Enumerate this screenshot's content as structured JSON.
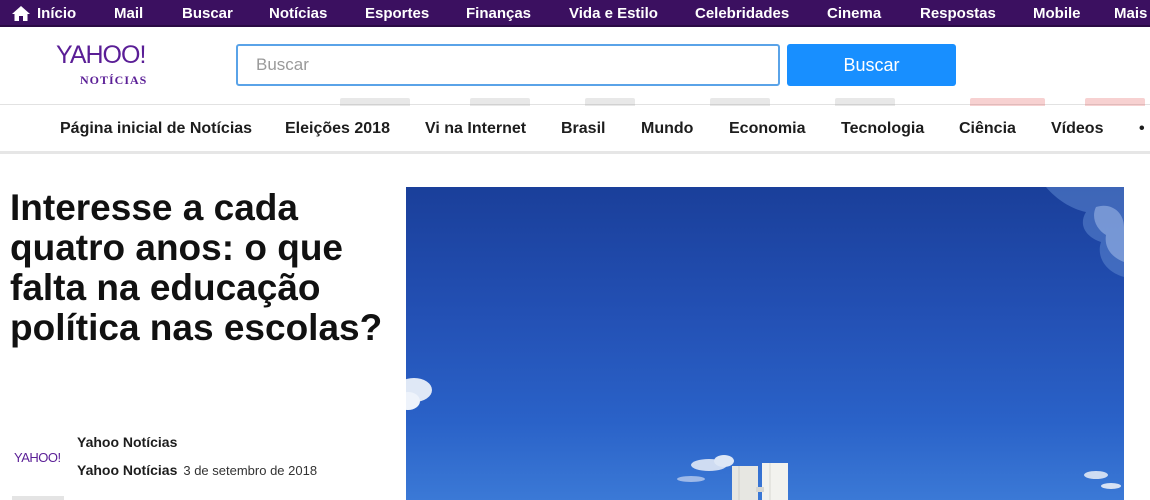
{
  "topbar": {
    "items": [
      "Início",
      "Mail",
      "Buscar",
      "Notícias",
      "Esportes",
      "Finanças",
      "Vida e Estilo",
      "Celebridades",
      "Cinema",
      "Respostas",
      "Mobile",
      "Mais"
    ],
    "icon": "home-icon",
    "background": "#3b1060"
  },
  "header": {
    "logo_main": "YAHOO!",
    "logo_sub": "NOTÍCIAS",
    "search_placeholder": "Buscar",
    "search_button": "Buscar",
    "accent": "#188fff",
    "brand": "#5a1e96"
  },
  "nav": {
    "items": [
      "Página inicial de Notícias",
      "Eleições 2018",
      "Vi na Internet",
      "Brasil",
      "Mundo",
      "Economia",
      "Tecnologia",
      "Ciência",
      "Vídeos",
      "•"
    ]
  },
  "article": {
    "headline": "Interesse a cada quatro anos: o que falta na educação política nas escolas?",
    "source_logo": "YAHOO!",
    "source_name": "Yahoo Notícias",
    "author": "Yahoo Notícias",
    "date": "3 de setembro de 2018"
  }
}
